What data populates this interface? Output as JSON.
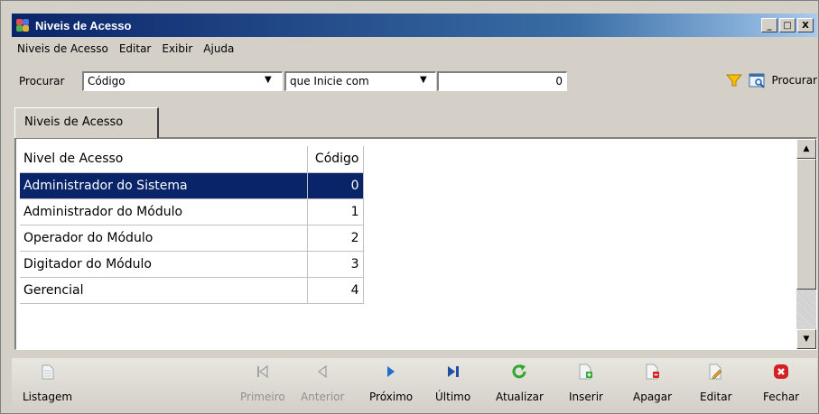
{
  "window": {
    "title": "Niveis de Acesso",
    "controls": [
      "_",
      "□",
      "X"
    ]
  },
  "menu": [
    "Niveis de Acesso",
    "Editar",
    "Exibir",
    "Ajuda"
  ],
  "search": {
    "label": "Procurar",
    "field_value": "Código",
    "condition_value": "que Inicie com",
    "value": "0",
    "button_label": "Procurar",
    "icons": [
      "filter-icon",
      "search-window-icon"
    ]
  },
  "tab": {
    "label": "Niveis de Acesso"
  },
  "table": {
    "headers": [
      "Nivel de Acesso",
      "Código"
    ],
    "rows": [
      {
        "name": "Administrador do Sistema",
        "code": "0",
        "selected": true
      },
      {
        "name": "Administrador do Módulo",
        "code": "1"
      },
      {
        "name": "Operador do Módulo",
        "code": "2"
      },
      {
        "name": "Digitador do Módulo",
        "code": "3"
      },
      {
        "name": "Gerencial",
        "code": "4"
      }
    ]
  },
  "toolbar": {
    "listagem": "Listagem",
    "primeiro": "Primeiro",
    "anterior": "Anterior",
    "proximo": "Próximo",
    "ultimo": "Último",
    "atualizar": "Atualizar",
    "inserir": "Inserir",
    "apagar": "Apagar",
    "editar": "Editar",
    "fechar": "Fechar"
  },
  "colors": {
    "selection": "#0a246a",
    "title_gradient_start": "#0a246a",
    "nav_blue": "#1e6fd0",
    "refresh_green": "#2fa82f",
    "close_red": "#d42020"
  }
}
